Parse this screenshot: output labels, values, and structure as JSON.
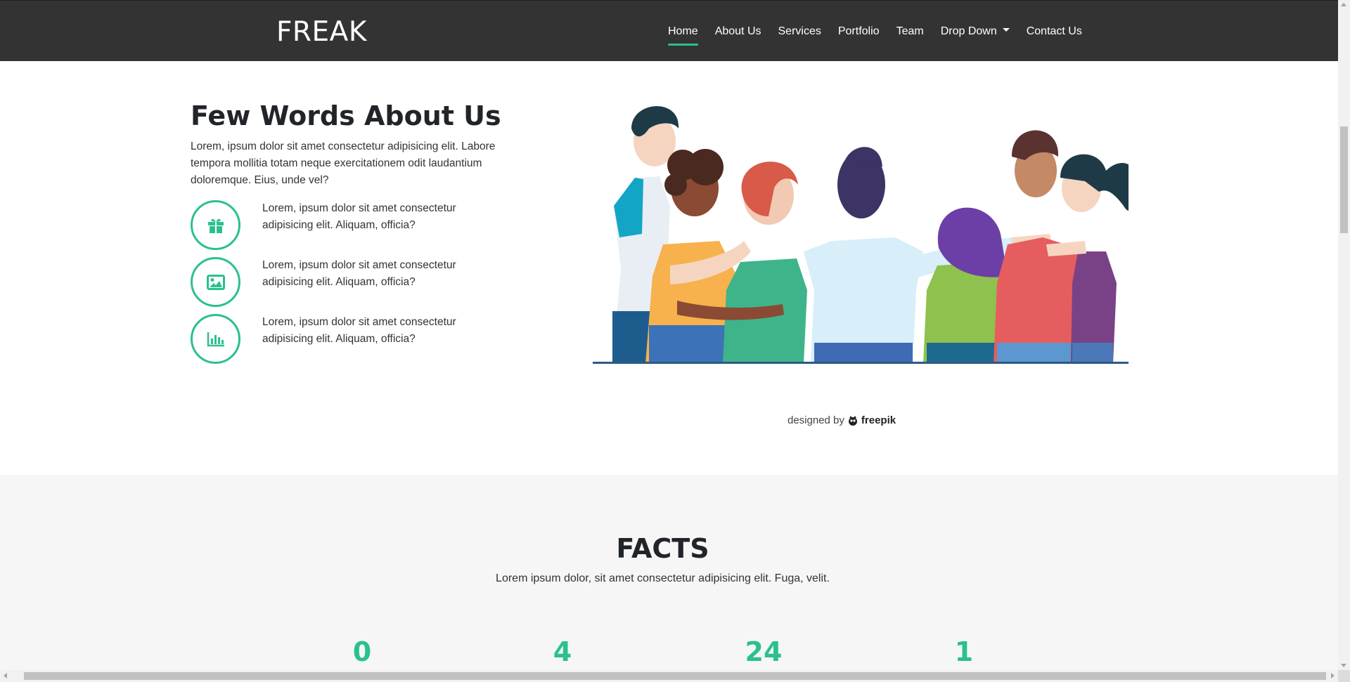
{
  "navbar": {
    "brand": "FREAK",
    "items": [
      {
        "label": "Home",
        "active": true
      },
      {
        "label": "About Us"
      },
      {
        "label": "Services"
      },
      {
        "label": "Portfolio"
      },
      {
        "label": "Team"
      },
      {
        "label": "Drop Down",
        "dropdown": true
      },
      {
        "label": "Contact Us"
      }
    ]
  },
  "about": {
    "title": "Few Words About Us",
    "text": "Lorem, ipsum dolor sit amet consectetur adipisicing elit. Labore tempora mollitia totam neque exercitationem odit laudantium doloremque. Eius, unde vel?",
    "features": [
      {
        "icon": "gift-icon",
        "text": "Lorem, ipsum dolor sit amet consectetur adipisicing elit. Aliquam, officia?"
      },
      {
        "icon": "image-icon",
        "text": "Lorem, ipsum dolor sit amet consectetur adipisicing elit. Aliquam, officia?"
      },
      {
        "icon": "bar-chart-icon",
        "text": "Lorem, ipsum dolor sit amet consectetur adipisicing elit. Aliquam, officia?"
      }
    ],
    "credit_prefix": "designed by",
    "credit_brand": "freepik"
  },
  "facts": {
    "title": "FACTS",
    "subtitle": "Lorem ipsum dolor, sit amet consectetur adipisicing elit. Fuga, velit.",
    "numbers": [
      "0",
      "4",
      "24",
      "1"
    ]
  },
  "colors": {
    "navbar_bg": "#333333",
    "accent": "#2bc08e",
    "facts_bg": "#f6f6f6"
  }
}
